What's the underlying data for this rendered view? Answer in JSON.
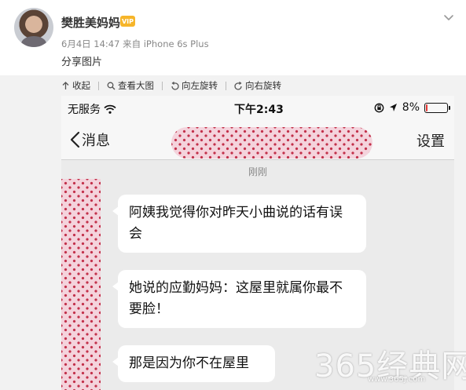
{
  "post": {
    "username": "樊胜美妈妈",
    "vip_label": "VIP",
    "meta": "6月4日 14:47 来自 iPhone 6s Plus",
    "text": "分享图片"
  },
  "toolbar": {
    "collapse": "收起",
    "view_large": "查看大图",
    "rotate_left": "向左旋转",
    "rotate_right": "向右旋转"
  },
  "phone": {
    "carrier": "无服务",
    "time": "下午2:43",
    "battery": "8%",
    "battery_level": 0.08,
    "back_label": "消息",
    "settings_label": "设置",
    "timestamp": "刚刚",
    "messages": [
      {
        "text": "阿姨我觉得你对昨天小曲说的话有误会"
      },
      {
        "text": "她说的应勤妈妈：这屋里就属你最不要脸！"
      },
      {
        "text": "那是因为你不在屋里"
      }
    ]
  },
  "watermark": {
    "brand": "365经典网",
    "url": "www.365j.com"
  },
  "colors": {
    "accent_red": "#e53935",
    "vip_gold": "#f6b52a",
    "pixelation_pink": "#f4d3dc"
  }
}
